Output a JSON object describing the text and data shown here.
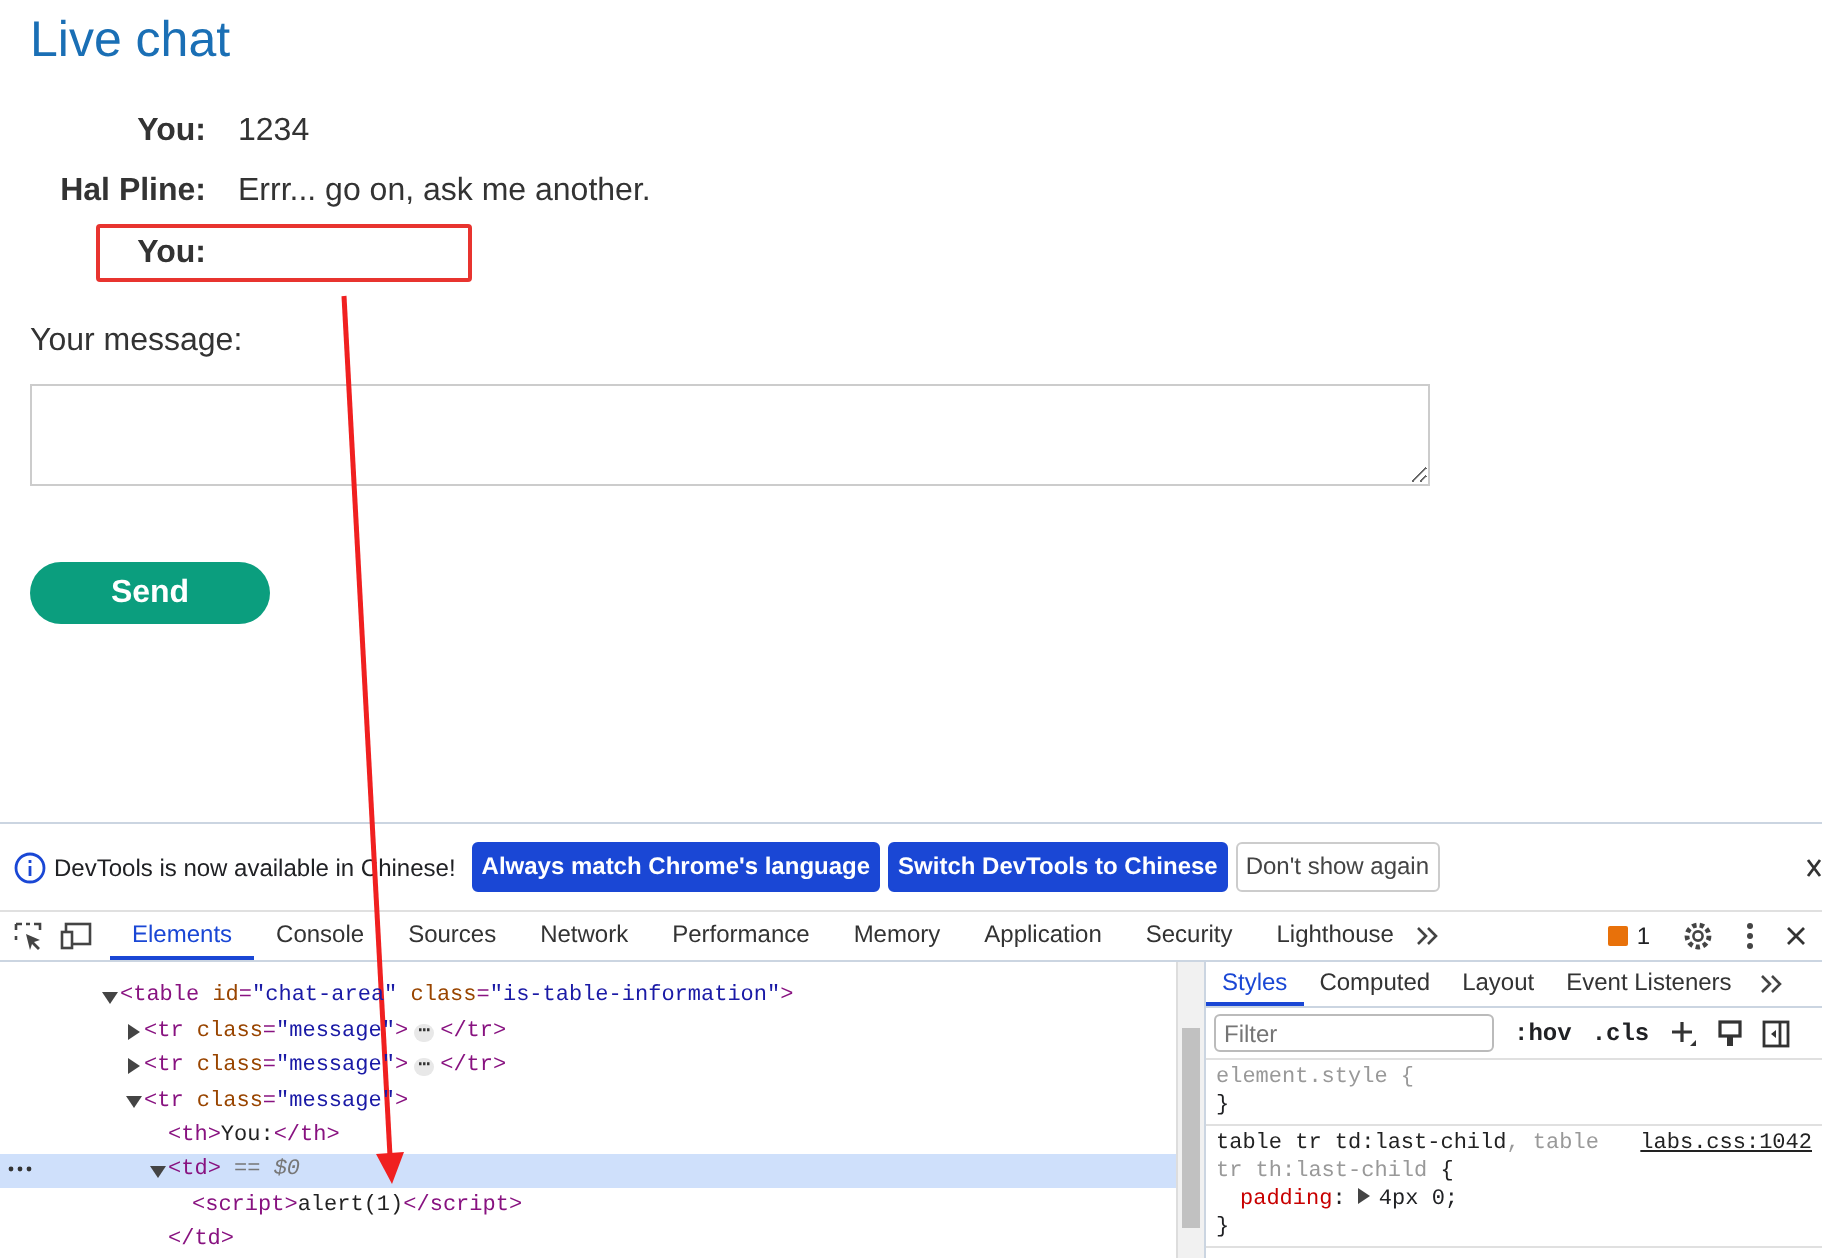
{
  "page": {
    "title": "Live chat",
    "messages": [
      {
        "author": "You:",
        "text": "1234",
        "highlighted": false
      },
      {
        "author": "Hal Pline:",
        "text": "Errr... go on, ask me another.",
        "highlighted": false
      },
      {
        "author": "You:",
        "highlighted": true
      }
    ],
    "message_label": "Your message:",
    "send_button": "Send"
  },
  "devtools": {
    "infobar": {
      "text": "DevTools is now available in Chinese!",
      "buttons": [
        {
          "label": "Always match Chrome's language",
          "kind": "primary"
        },
        {
          "label": "Switch DevTools to Chinese",
          "kind": "primary"
        },
        {
          "label": "Don't show again",
          "kind": "secondary"
        }
      ]
    },
    "tabs": [
      {
        "label": "Elements",
        "selected": true
      },
      {
        "label": "Console",
        "selected": false
      },
      {
        "label": "Sources",
        "selected": false
      },
      {
        "label": "Network",
        "selected": false
      },
      {
        "label": "Performance",
        "selected": false
      },
      {
        "label": "Memory",
        "selected": false
      },
      {
        "label": "Application",
        "selected": false
      },
      {
        "label": "Security",
        "selected": false
      },
      {
        "label": "Lighthouse",
        "selected": false
      }
    ],
    "issues_count": "1",
    "dom_tree": [
      {
        "text": "<table id=\"chat-area\" class=\"is-table-information\">",
        "expanded": true,
        "selected": false,
        "children": [
          {
            "text": "<tr class=\"message\">",
            "expanded": false,
            "selected": false,
            "ellipsis": "⋯",
            "close": "</tr>"
          },
          {
            "text": "<tr class=\"message\">",
            "expanded": false,
            "selected": false,
            "ellipsis": "⋯",
            "close": "</tr>"
          },
          {
            "text": "<tr class=\"message\">",
            "expanded": true,
            "selected": false,
            "children": [
              {
                "text": "<th>You:</th>",
                "selected": false
              },
              {
                "text": "<td>",
                "expanded": true,
                "selected": true,
                "note": "== $0",
                "close": "</td>",
                "children": [
                  {
                    "text": "<script>alert(1)</script>",
                    "selected": false
                  }
                ]
              }
            ]
          }
        ]
      }
    ],
    "sidebar_tabs": [
      {
        "label": "Styles",
        "selected": true
      },
      {
        "label": "Computed",
        "selected": false
      },
      {
        "label": "Layout",
        "selected": false
      },
      {
        "label": "Event Listeners",
        "selected": false
      }
    ],
    "filter": {
      "placeholder": "Filter"
    },
    "toggles": [
      ":hov",
      ".cls"
    ],
    "rules": [
      {
        "selectors": [
          {
            "text": "element.style {",
            "matched": false
          }
        ],
        "close": "}"
      },
      {
        "selectors": [
          {
            "text": "table tr td:last-child",
            "matched": true
          },
          {
            "text": ", table tr th:last-child",
            "matched": false
          },
          {
            "text": " {",
            "matched": true
          }
        ],
        "source": "labs.css:1042",
        "declarations": [
          {
            "name": "padding",
            "colon": ":",
            "value": "4px 0;"
          }
        ],
        "close": "}"
      }
    ]
  }
}
